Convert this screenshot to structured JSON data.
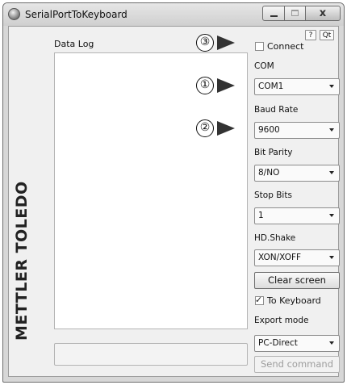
{
  "window": {
    "title": "SerialPortToKeyboard",
    "close_glyph": "x"
  },
  "brand": {
    "text": "METTLER TOLEDO"
  },
  "log": {
    "label": "Data Log"
  },
  "help": {
    "help_label": "?",
    "qt_label": "Qt"
  },
  "connect": {
    "label": "Connect",
    "checked": false
  },
  "com": {
    "label": "COM",
    "value": "COM1"
  },
  "baud": {
    "label": "Baud Rate",
    "value": "9600"
  },
  "parity": {
    "label": "Bit Parity",
    "value": "8/NO"
  },
  "stop": {
    "label": "Stop Bits",
    "value": "1"
  },
  "handshake": {
    "label": "HD.Shake",
    "value": "XON/XOFF"
  },
  "clear_button": {
    "label": "Clear screen"
  },
  "to_keyboard": {
    "label": "To Keyboard",
    "checked": true
  },
  "export": {
    "label": "Export mode",
    "value": "PC-Direct"
  },
  "send_button": {
    "label": "Send command",
    "enabled": false
  },
  "annotations": {
    "one": "①",
    "two": "②",
    "three": "③"
  }
}
